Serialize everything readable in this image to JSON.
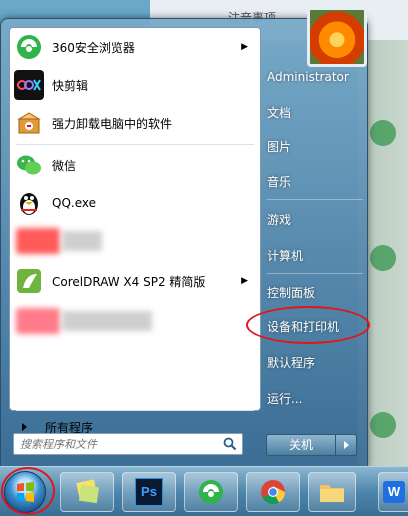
{
  "background": {
    "doc_title": "注音事项"
  },
  "start_menu": {
    "pinned_items": [
      {
        "label": "360安全浏览器",
        "icon": "360-browser-icon",
        "has_submenu": true
      },
      {
        "label": "快剪辑",
        "icon": "kuaijianji-icon",
        "has_submenu": false
      },
      {
        "label": "强力卸载电脑中的软件",
        "icon": "uninstall-box-icon",
        "has_submenu": false
      }
    ],
    "recent_items": [
      {
        "label": "微信",
        "icon": "wechat-icon"
      },
      {
        "label": "QQ.exe",
        "icon": "qq-penguin-icon"
      },
      {
        "label": "CorelDRAW X4 SP2 精简版",
        "icon": "coreldraw-icon",
        "has_submenu": true
      }
    ],
    "all_programs_label": "所有程序",
    "search_placeholder": "搜索程序和文件",
    "right_pane": {
      "user_name": "Administrator",
      "items": [
        "文档",
        "图片",
        "音乐",
        "游戏",
        "计算机",
        "控制面板",
        "设备和打印机",
        "默认程序",
        "运行..."
      ],
      "shutdown_label": "关机"
    }
  },
  "taskbar": {
    "apps": [
      "start-orb-icon",
      "sticky-notes-icon",
      "photoshop-icon",
      "360-browser-icon",
      "chrome-icon",
      "explorer-folder-icon",
      "wps-icon"
    ],
    "photoshop_text": "Ps",
    "wps_text": "W"
  },
  "annotations": {
    "highlight_color": "#e0161a"
  }
}
